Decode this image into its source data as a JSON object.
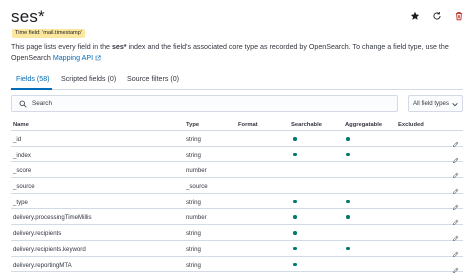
{
  "header": {
    "title": "ses*",
    "time_field_badge": "Time field: 'mail.timestamp'"
  },
  "description": {
    "part1": "This page lists every field in the ",
    "index": "ses*",
    "part2": " index and the field's associated core type as recorded by OpenSearch. To change a field type, use the OpenSearch ",
    "link": "Mapping API"
  },
  "tabs": [
    {
      "label": "Fields (58)",
      "active": true
    },
    {
      "label": "Scripted fields (0)",
      "active": false
    },
    {
      "label": "Source filters (0)",
      "active": false
    }
  ],
  "search": {
    "placeholder": "Search"
  },
  "filter": {
    "label": "All field types"
  },
  "table": {
    "headers": [
      "Name",
      "Type",
      "Format",
      "Searchable",
      "Aggregatable",
      "Excluded"
    ],
    "rows": [
      {
        "name": "_id",
        "type": "string",
        "searchable": true,
        "aggregatable": true
      },
      {
        "name": "_index",
        "type": "string",
        "searchable": true,
        "aggregatable": true
      },
      {
        "name": "_score",
        "type": "number",
        "searchable": false,
        "aggregatable": false
      },
      {
        "name": "_source",
        "type": "_source",
        "searchable": false,
        "aggregatable": false
      },
      {
        "name": "_type",
        "type": "string",
        "searchable": true,
        "aggregatable": true
      },
      {
        "name": "delivery.processingTimeMillis",
        "type": "number",
        "searchable": true,
        "aggregatable": true
      },
      {
        "name": "delivery.recipients",
        "type": "string",
        "searchable": true,
        "aggregatable": false
      },
      {
        "name": "delivery.recipients.keyword",
        "type": "string",
        "searchable": true,
        "aggregatable": true
      },
      {
        "name": "delivery.reportingMTA",
        "type": "string",
        "searchable": true,
        "aggregatable": false
      }
    ]
  },
  "colors": {
    "accent": "#006bb8",
    "dot": "#007871",
    "badge": "#fce79f",
    "delete": "#bd271e"
  },
  "icons": [
    "star-icon",
    "refresh-icon",
    "delete-icon",
    "external-link-icon",
    "search-icon",
    "chevron-down-icon",
    "pencil-icon"
  ]
}
